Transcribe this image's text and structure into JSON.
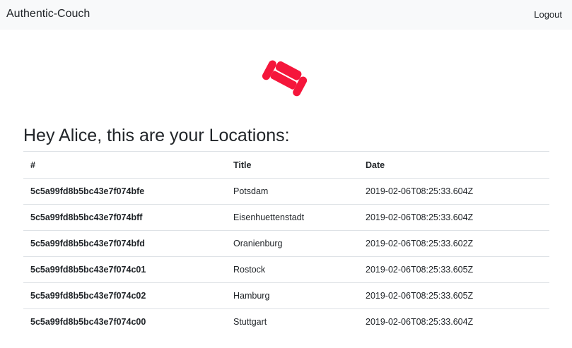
{
  "navbar": {
    "brand": "Authentic-Couch",
    "logout_label": "Logout"
  },
  "logo": {
    "icon": "couch-icon",
    "color": "#f5163b"
  },
  "main": {
    "heading": "Hey Alice, this are your Locations:"
  },
  "table": {
    "headers": [
      "#",
      "Title",
      "Date"
    ],
    "rows": [
      {
        "id": "5c5a99fd8b5bc43e7f074bfe",
        "title": "Potsdam",
        "date": "2019-02-06T08:25:33.604Z"
      },
      {
        "id": "5c5a99fd8b5bc43e7f074bff",
        "title": "Eisenhuettenstadt",
        "date": "2019-02-06T08:25:33.604Z"
      },
      {
        "id": "5c5a99fd8b5bc43e7f074bfd",
        "title": "Oranienburg",
        "date": "2019-02-06T08:25:33.602Z"
      },
      {
        "id": "5c5a99fd8b5bc43e7f074c01",
        "title": "Rostock",
        "date": "2019-02-06T08:25:33.605Z"
      },
      {
        "id": "5c5a99fd8b5bc43e7f074c02",
        "title": "Hamburg",
        "date": "2019-02-06T08:25:33.605Z"
      },
      {
        "id": "5c5a99fd8b5bc43e7f074c00",
        "title": "Stuttgart",
        "date": "2019-02-06T08:25:33.604Z"
      }
    ]
  }
}
